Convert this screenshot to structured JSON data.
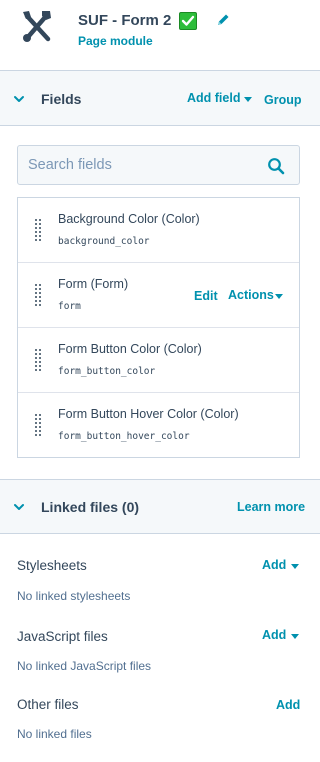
{
  "header": {
    "title": "SUF - Form 2",
    "subtitle": "Page module",
    "check_icon": "check-mark-icon",
    "edit_icon": "pencil-icon",
    "module_icon": "tools-icon",
    "accent_color": "#0091ae",
    "check_color": "#2dbd3a"
  },
  "fields_section": {
    "title": "Fields",
    "add_field_label": "Add field",
    "group_label": "Group"
  },
  "search": {
    "placeholder": "Search fields"
  },
  "fields": [
    {
      "label": "Background Color (Color)",
      "name": "background_color"
    },
    {
      "label": "Form (Form)",
      "name": "form",
      "edit_label": "Edit",
      "actions_label": "Actions"
    },
    {
      "label": "Form Button Color (Color)",
      "name": "form_button_color"
    },
    {
      "label": "Form Button Hover Color (Color)",
      "name": "form_button_hover_color"
    }
  ],
  "linked_files": {
    "title": "Linked files (0)",
    "learn_more_label": "Learn more",
    "stylesheets": {
      "title": "Stylesheets",
      "add_label": "Add",
      "empty": "No linked stylesheets"
    },
    "javascript": {
      "title": "JavaScript files",
      "add_label": "Add",
      "empty": "No linked JavaScript files"
    },
    "other": {
      "title": "Other files",
      "add_label": "Add",
      "empty": "No linked files"
    }
  }
}
